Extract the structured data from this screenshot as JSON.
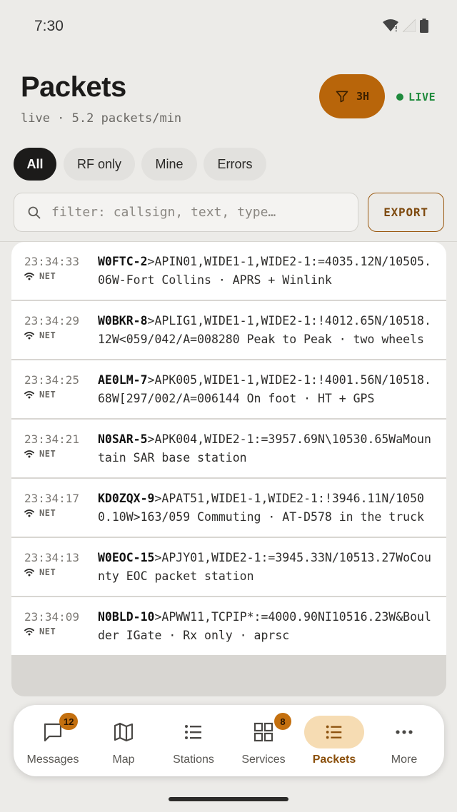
{
  "status_bar": {
    "time": "7:30"
  },
  "header": {
    "title": "Packets",
    "subtitle": "live · 5.2 packets/min",
    "range_label": "3H",
    "live_label": "LIVE"
  },
  "chips": [
    {
      "label": "All",
      "active": true
    },
    {
      "label": "RF only",
      "active": false
    },
    {
      "label": "Mine",
      "active": false
    },
    {
      "label": "Errors",
      "active": false
    }
  ],
  "search": {
    "placeholder": "filter: callsign, text, type…",
    "value": ""
  },
  "export_label": "EXPORT",
  "packets": [
    {
      "time": "23:34:33",
      "source": "NET",
      "callsign": "W0FTC-2",
      "payload": ">APIN01,WIDE1-1,WIDE2-1:=4035.12N/10505.06W-Fort Collins · APRS + Winlink"
    },
    {
      "time": "23:34:29",
      "source": "NET",
      "callsign": "W0BKR-8",
      "payload": ">APLIG1,WIDE1-1,WIDE2-1:!4012.65N/10518.12W<059/042/A=008280 Peak to Peak · two wheels"
    },
    {
      "time": "23:34:25",
      "source": "NET",
      "callsign": "AE0LM-7",
      "payload": ">APK005,WIDE1-1,WIDE2-1:!4001.56N/10518.68W[297/002/A=006144 On foot · HT + GPS"
    },
    {
      "time": "23:34:21",
      "source": "NET",
      "callsign": "N0SAR-5",
      "payload": ">APK004,WIDE2-1:=3957.69N\\10530.65WaMountain SAR base station"
    },
    {
      "time": "23:34:17",
      "source": "NET",
      "callsign": "KD0ZQX-9",
      "payload": ">APAT51,WIDE1-1,WIDE2-1:!3946.11N/10500.10W>163/059 Commuting · AT-D578 in the truck"
    },
    {
      "time": "23:34:13",
      "source": "NET",
      "callsign": "W0EOC-15",
      "payload": ">APJY01,WIDE2-1:=3945.33N/10513.27WoCounty EOC packet station"
    },
    {
      "time": "23:34:09",
      "source": "NET",
      "callsign": "N0BLD-10",
      "payload": ">APWW11,TCPIP*:=4000.90NI10516.23W&Boulder IGate · Rx only · aprsc"
    }
  ],
  "nav": [
    {
      "label": "Messages",
      "icon": "message-icon",
      "badge": "12",
      "active": false
    },
    {
      "label": "Map",
      "icon": "map-icon",
      "badge": "",
      "active": false
    },
    {
      "label": "Stations",
      "icon": "list-icon",
      "badge": "",
      "active": false
    },
    {
      "label": "Services",
      "icon": "grid-icon",
      "badge": "8",
      "active": false
    },
    {
      "label": "Packets",
      "icon": "packets-icon",
      "badge": "",
      "active": true
    },
    {
      "label": "More",
      "icon": "more-icon",
      "badge": "",
      "active": false
    }
  ],
  "colors": {
    "accent": "#b8650a",
    "live_green": "#1f8a3c",
    "background": "#ecebe8"
  }
}
